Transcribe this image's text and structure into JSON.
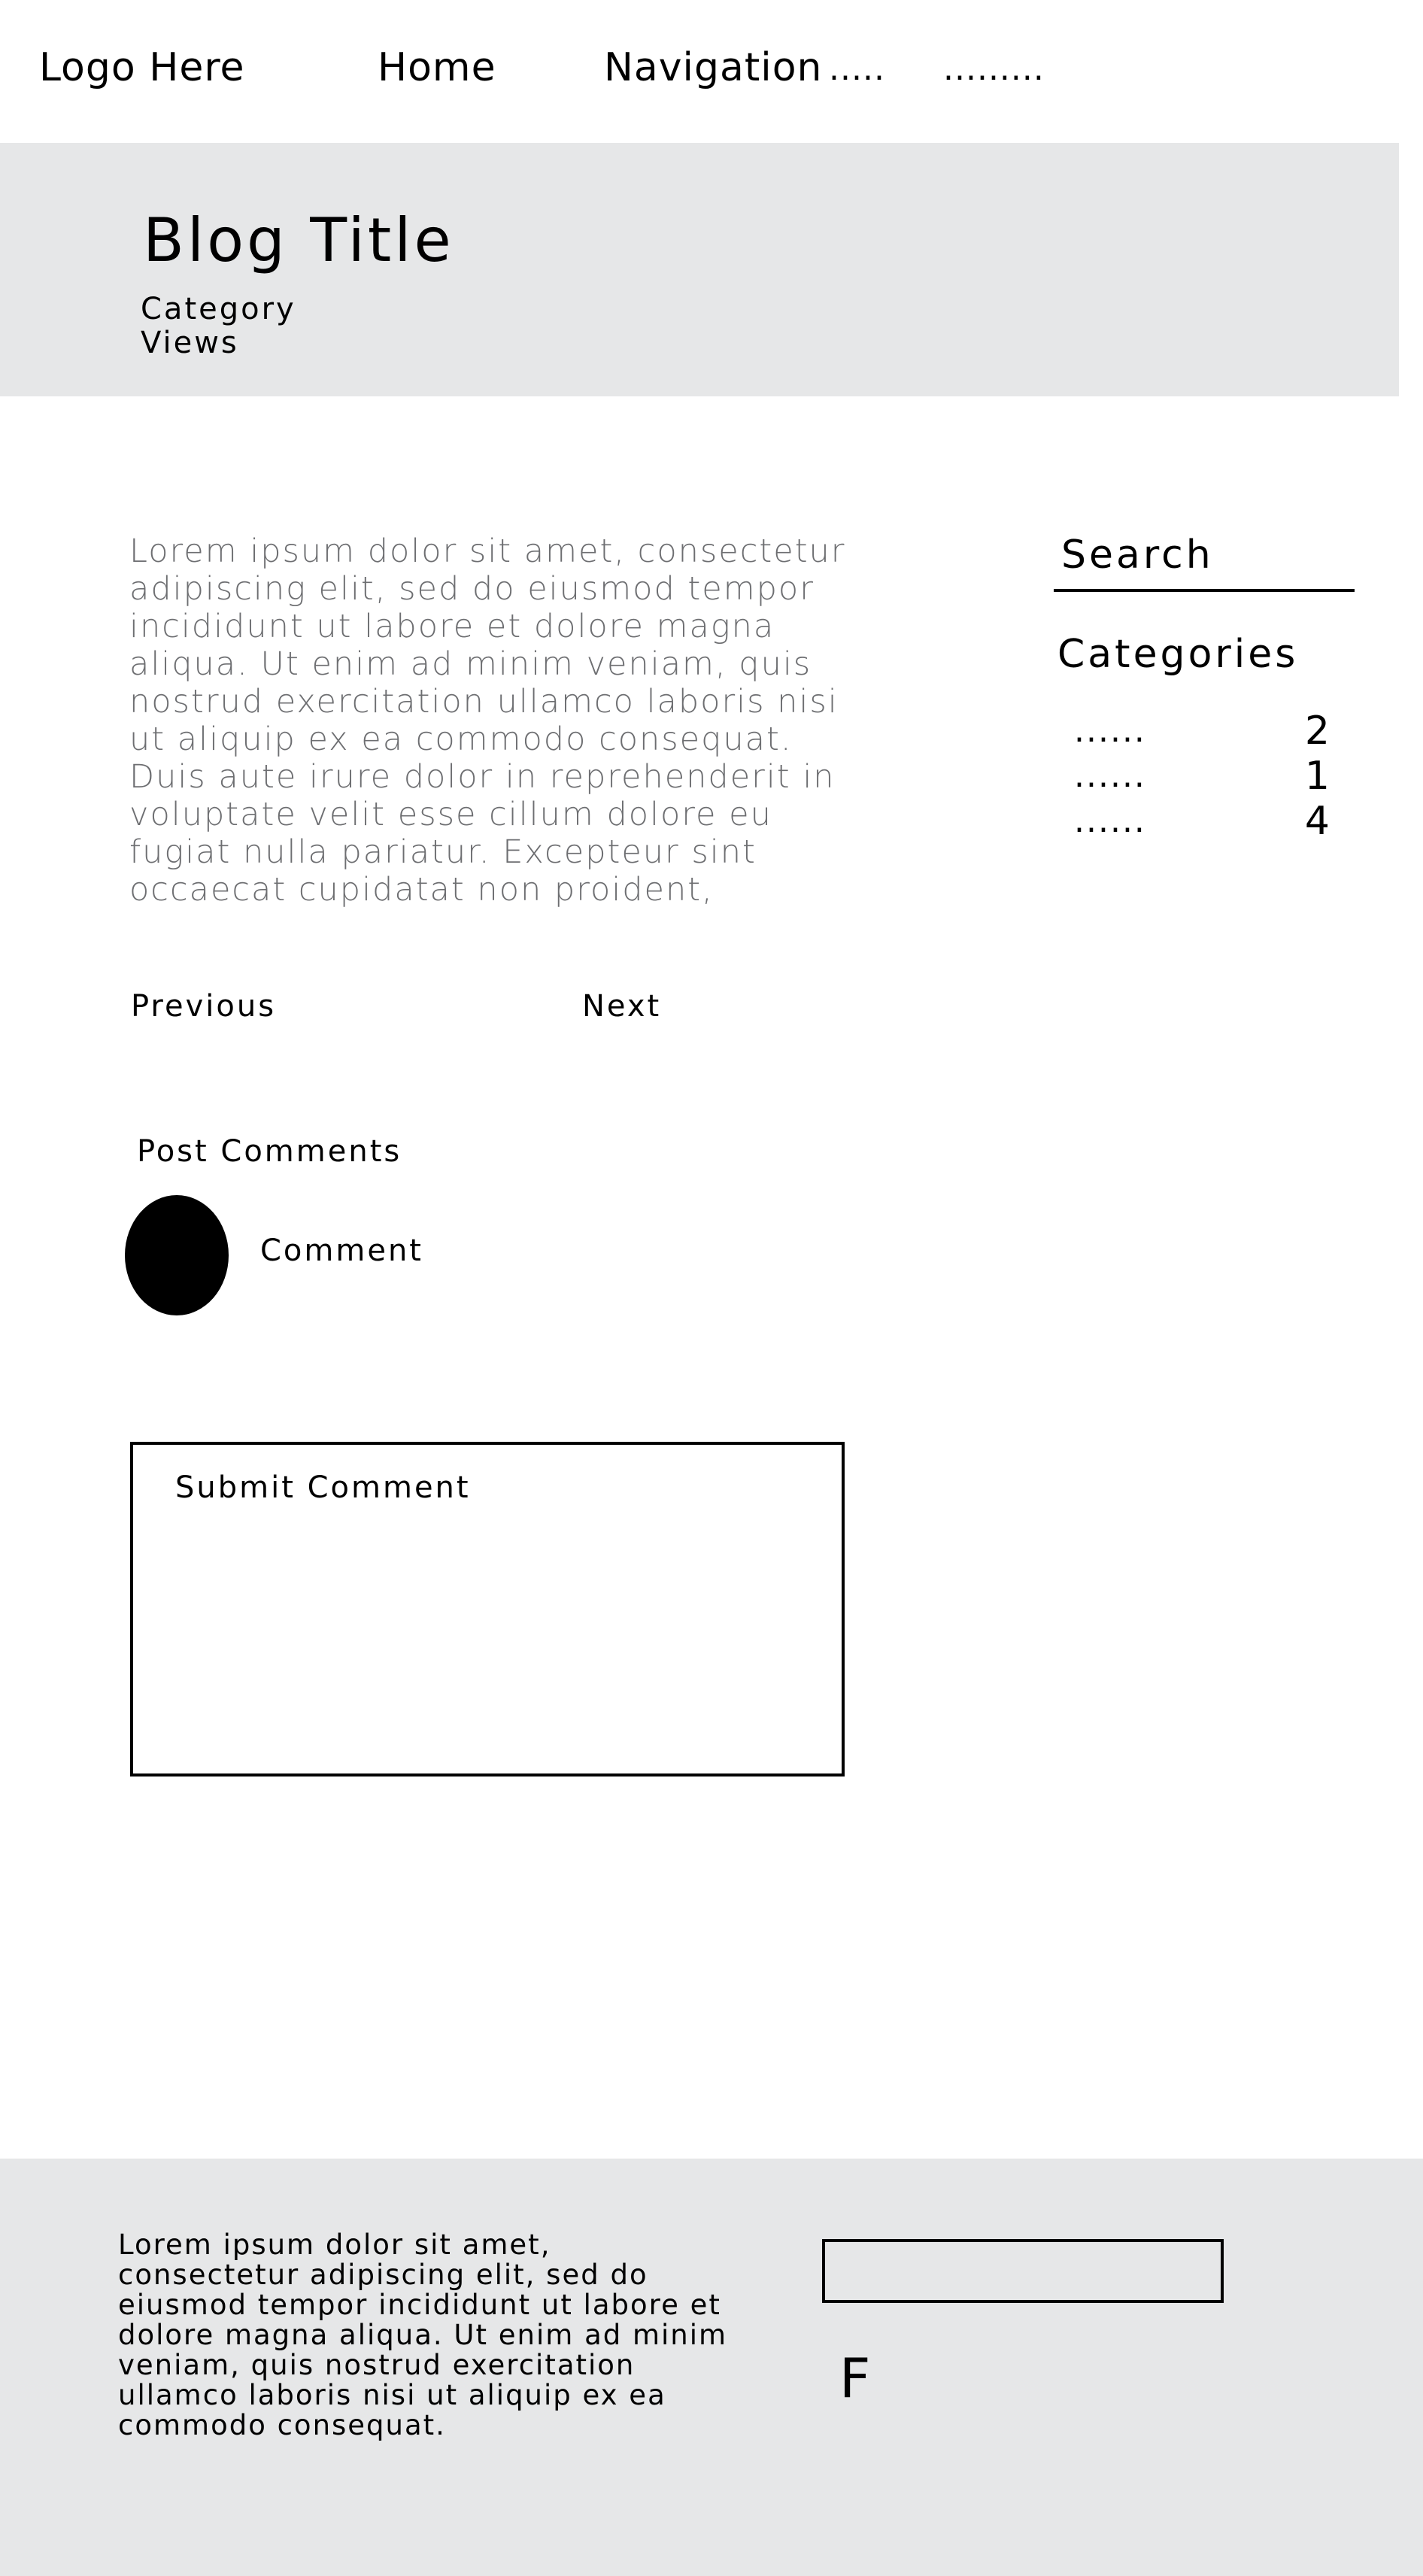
{
  "nav": {
    "logo": "Logo  Here",
    "home": "Home",
    "navigation": "Navigation",
    "more_1": ".....",
    "more_2": "........."
  },
  "hero": {
    "title": "Blog Title",
    "category": "Category",
    "views": "Views"
  },
  "post": {
    "body": "Lorem ipsum dolor sit amet, consectetur adipiscing elit, sed do eiusmod tempor incididunt ut labore et dolore magna aliqua. Ut enim ad minim veniam, quis nostrud exercitation ullamco laboris nisi ut aliquip ex ea commodo consequat. Duis aute irure dolor in reprehenderit in voluptate velit esse cillum dolore eu fugiat nulla pariatur. Excepteur sint occaecat cupidatat non proident,",
    "previous": "Previous",
    "next": "Next"
  },
  "comments": {
    "heading": "Post Comments",
    "comment": "Comment",
    "submit": "Submit Comment"
  },
  "sidebar": {
    "search": "Search",
    "categories_title": "Categories",
    "categories": [
      {
        "name": "......",
        "count": "2"
      },
      {
        "name": "......",
        "count": "1"
      },
      {
        "name": "......",
        "count": "4"
      }
    ]
  },
  "footer": {
    "text": "Lorem ipsum dolor sit amet, consectetur adipiscing elit, sed do eiusmod tempor incididunt ut labore et dolore magna aliqua. Ut enim ad minim veniam, quis nostrud exercitation ullamco laboris nisi ut aliquip ex ea commodo consequat.",
    "input_value": "",
    "letter": "F"
  },
  "colors": {
    "background": "#ffffff",
    "panel_gray": "#e6e7e8",
    "body_text_gray": "#6d6e71",
    "ink": "#000000"
  }
}
